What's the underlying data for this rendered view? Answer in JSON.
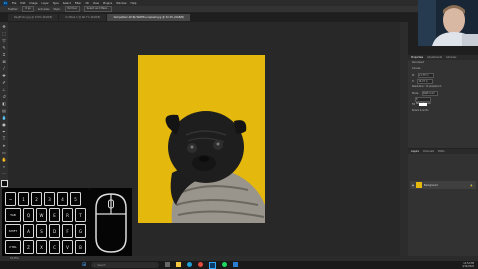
{
  "menubar": {
    "logo": "Ps",
    "items": [
      "File",
      "Edit",
      "Image",
      "Layer",
      "Type",
      "Select",
      "Filter",
      "3D",
      "View",
      "Plugins",
      "Window",
      "Help"
    ]
  },
  "options": {
    "items": [
      "Feather:",
      "0 px",
      "Anti-alias",
      "Style:",
      "Normal",
      "Select and Mask..."
    ]
  },
  "tabs": [
    {
      "label": "RagPhoto.jpg @ 100% (RGB/8)"
    },
    {
      "label": "Untitled-1 @ 66.7% (RGB/8)"
    },
    {
      "label": "darkpattern-WcRjcWWMt-unsplash.jpg @ 32.4% (RGB/8)"
    }
  ],
  "panel": {
    "tabs": [
      "Properties",
      "Adjustments",
      "Libraries"
    ],
    "section_label": "Document",
    "canvas_label": "Canvas",
    "width_label": "W",
    "width_value": "11.75 in",
    "height_label": "H",
    "height_value": "15.27 in",
    "resolution": "Resolution: 72 pixels/inch",
    "mode_label": "Mode",
    "mode_value": "RGB Color",
    "bits_value": "8 Bits/Channel",
    "fill_label": "Fill",
    "rulers_label": "Rulers & Grids"
  },
  "layers": {
    "tabs": [
      "Layers",
      "Channels",
      "Paths"
    ],
    "layer_name": "Background"
  },
  "statusbar": {
    "zoom": "32.35%"
  },
  "taskbar": {
    "search_placeholder": "Search",
    "time": "12:52 PM",
    "date": "3/14/2022"
  },
  "keyboard": {
    "rows": [
      [
        "~",
        "1",
        "2",
        "3",
        "4",
        "5"
      ],
      [
        "TAB",
        "Q",
        "W",
        "E",
        "R",
        "T"
      ],
      [
        "SHIFT",
        "A",
        "S",
        "D",
        "F",
        "G"
      ],
      [
        "CTRL",
        "Z",
        "X",
        "C",
        "V",
        "B"
      ]
    ]
  }
}
